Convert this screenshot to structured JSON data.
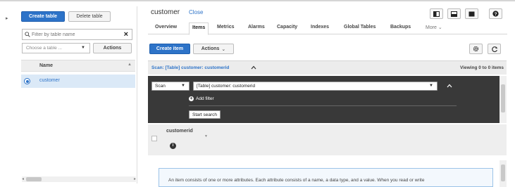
{
  "left": {
    "create_table": "Create table",
    "delete_table": "Delete table",
    "filter_placeholder": "Filter by table name",
    "choose_placeholder": "Choose a table ...",
    "actions": "Actions",
    "column_name": "Name",
    "rows": [
      {
        "name": "customer",
        "selected": true
      }
    ]
  },
  "header": {
    "title": "customer",
    "close": "Close"
  },
  "tabs": [
    {
      "label": "Overview"
    },
    {
      "label": "Items",
      "active": true
    },
    {
      "label": "Metrics"
    },
    {
      "label": "Alarms"
    },
    {
      "label": "Capacity"
    },
    {
      "label": "Indexes"
    },
    {
      "label": "Global Tables"
    },
    {
      "label": "Backups"
    },
    {
      "label": "More"
    }
  ],
  "toolbar": {
    "create_item": "Create item",
    "actions": "Actions"
  },
  "scan": {
    "header_label": "Scan: [Table] customer: customerid",
    "viewing": "Viewing 0 to 0 items",
    "mode": "Scan",
    "index": "[Table] customer: customerid",
    "add_filter": "Add filter",
    "start_search": "Start search"
  },
  "results": {
    "column": "customerid"
  },
  "info": {
    "text": "An item consists of one or more attributes. Each attribute consists of a name, a data type, and a value. When you read or write"
  },
  "colors": {
    "primary": "#2d73c8",
    "panel_dark": "#393939",
    "selected_row": "#dbe9f7"
  }
}
